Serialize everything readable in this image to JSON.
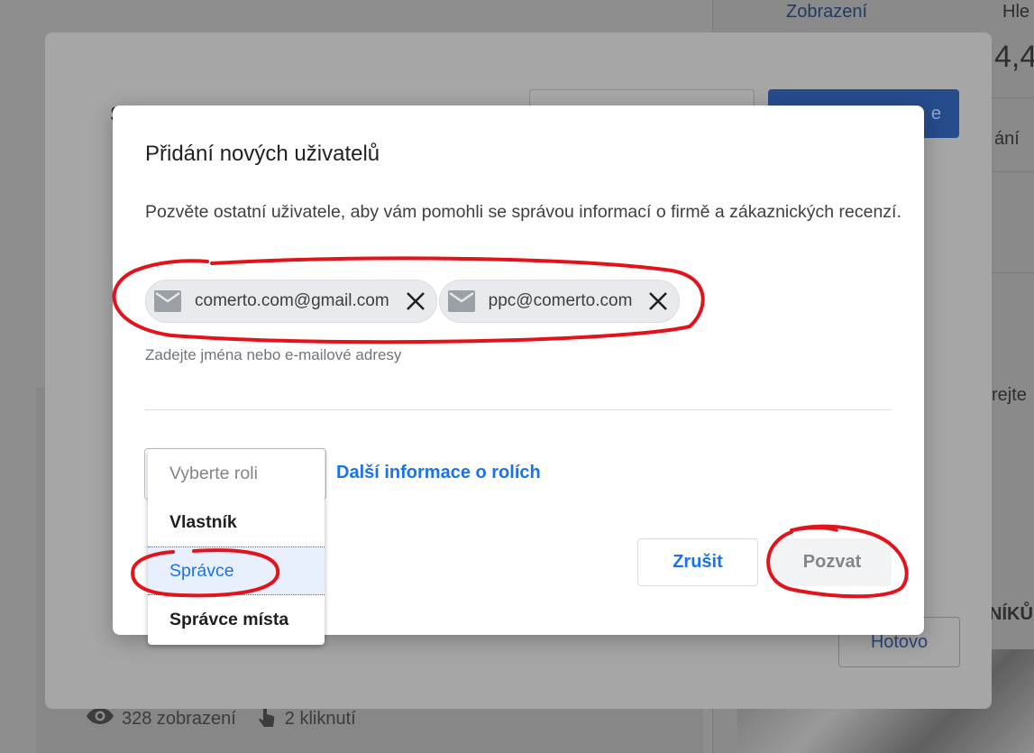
{
  "background": {
    "header_views": "Zobrazení",
    "header_search_partial": "Hle",
    "rating_partial": "4,4",
    "side_text_partial": "ání",
    "side_text_partial2": "rejte",
    "section_partial": "NÍKŮ",
    "done_label": "Hotovo",
    "stats": {
      "views": "328 zobrazení",
      "clicks": "2 kliknutí"
    }
  },
  "dialog": {
    "title": "Přidání nových uživatelů",
    "description": "Pozvěte ostatní uživatele, aby vám pomohli se správou informací o firmě a zákaznických recenzí.",
    "chips": [
      {
        "email": "comerto.com@gmail.com",
        "icon": "mail-icon"
      },
      {
        "email": "ppc@comerto.com",
        "icon": "mail-icon"
      }
    ],
    "input_hint": "Zadejte jména nebo e-mailové adresy",
    "role_select": {
      "placeholder": "Vyberte roli",
      "options": [
        "Vlastník",
        "Správce",
        "Správce místa"
      ],
      "highlighted": "Správce"
    },
    "roles_info_link": "Další informace o rolích",
    "cancel_label": "Zrušit",
    "invite_label": "Pozvat"
  },
  "colors": {
    "accent": "#1a73e8",
    "annotation": "#e3131b",
    "chip_bg": "#e8eaed",
    "disabled_text": "#80868b"
  }
}
